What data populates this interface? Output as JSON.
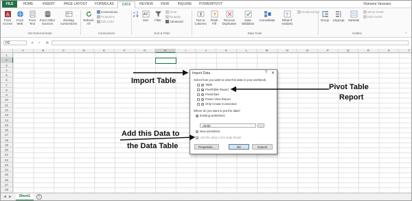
{
  "ribbon_tabs": [
    "FILE",
    "HOME",
    "INSERT",
    "PAGE LAYOUT",
    "FORMULAS",
    "DATA",
    "REVIEW",
    "VIEW",
    "INQUIRE",
    "POWERPIVOT"
  ],
  "active_tab": "DATA",
  "user_name": "Ramana Varanasi",
  "ribbon": {
    "from_access": "From Access",
    "from_web": "From Web",
    "from_text": "From Text",
    "from_other": "From Other Sources",
    "existing": "Existing Connections",
    "refresh_all": "Refresh All",
    "connections": "Connections",
    "properties": "Properties",
    "edit_links": "Edit Links",
    "sort": "Sort",
    "filter": "Filter",
    "clear": "Clear",
    "reapply": "Reapply",
    "advanced": "Advanced",
    "text_to_columns": "Text to Columns",
    "flash_fill": "Flash Fill",
    "remove_duplicates": "Remove Duplicates",
    "data_validation": "Data Validation",
    "consolidate": "Consolidate",
    "what_if": "What-If Analysis",
    "relationships": "Relationships",
    "group": "Group",
    "ungroup": "Ungroup",
    "subtotal": "Subtotal",
    "show_detail": "Show Detail",
    "hide_detail": "Hide Detail",
    "groups": [
      "Get External Data",
      "Connections",
      "Sort & Filter",
      "Data Tools",
      "Outline"
    ]
  },
  "name_box": "H2",
  "fx": "fx",
  "columns": [
    "A",
    "B",
    "C",
    "D",
    "E",
    "F",
    "G",
    "H",
    "I",
    "J",
    "K",
    "L",
    "M",
    "N",
    "O",
    "P",
    "Q",
    "R",
    "S",
    "T"
  ],
  "rows": [
    "1",
    "2",
    "3",
    "4",
    "5",
    "6",
    "7",
    "8",
    "9",
    "10",
    "11",
    "12",
    "13",
    "14",
    "15",
    "16",
    "17",
    "18",
    "19",
    "20",
    "21",
    "22",
    "23",
    "24",
    "25",
    "26",
    "27",
    "28"
  ],
  "selected_column": "H",
  "selected_row": "2",
  "sheet_tab": "Sheet1",
  "dialog": {
    "title": "Import Data",
    "help": "?",
    "close": "✕",
    "prompt": "Select how you want to view this data in your workbook.",
    "options": [
      "Table",
      "PivotTable Report",
      "PivotChart",
      "Power View Report",
      "Only Create Connection"
    ],
    "selected_option": "PivotTable Report",
    "where": "Where do you want to put the data?",
    "existing": "Existing worksheet:",
    "range": "=$H$2",
    "new_ws": "New worksheet",
    "add_model": "Add this data to the Data Model",
    "properties": "Properties...",
    "ok": "OK",
    "cancel": "Cancel"
  },
  "annotations": {
    "import_table": "Import Table",
    "pivot_line1": "Pivot Table",
    "pivot_line2": "Report",
    "add_line1": "Add this Data to",
    "add_line2": "the Data Table"
  }
}
